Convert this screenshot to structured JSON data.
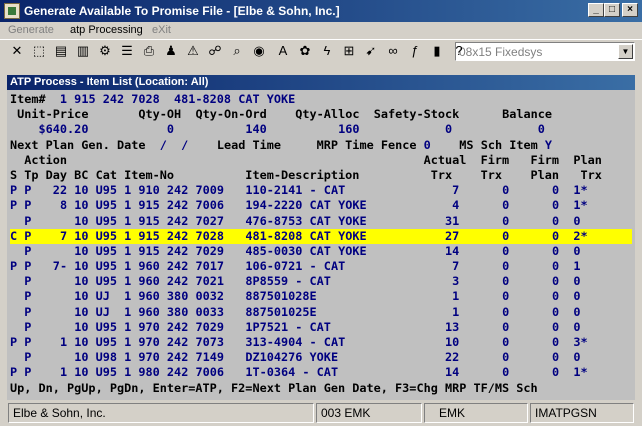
{
  "window": {
    "title": "Generate Available To Promise File - [Elbe & Sohn, Inc.]",
    "controls": [
      "_",
      "□",
      "×"
    ]
  },
  "menu": [
    {
      "label": "Generate",
      "enabled": false
    },
    {
      "label": "atp Processing",
      "enabled": true
    },
    {
      "label": "eXit",
      "enabled": false
    }
  ],
  "toolbar": {
    "buttons": [
      {
        "name": "close-icon",
        "glyph": "✕"
      },
      {
        "name": "select-icon",
        "glyph": "⬚"
      },
      {
        "name": "document-icon",
        "glyph": "▤"
      },
      {
        "name": "clipboard-icon",
        "glyph": "▥"
      },
      {
        "name": "settings-icon",
        "glyph": "⚙"
      },
      {
        "name": "list-icon",
        "glyph": "☰"
      },
      {
        "name": "print-icon",
        "glyph": "⎙"
      },
      {
        "name": "user-icon",
        "glyph": "♟"
      },
      {
        "name": "warning-icon",
        "glyph": "⚠"
      },
      {
        "name": "binoculars-icon",
        "glyph": "☍"
      },
      {
        "name": "search-icon",
        "glyph": "⌕"
      },
      {
        "name": "globe-icon",
        "glyph": "◉"
      },
      {
        "name": "font-icon",
        "glyph": "A"
      },
      {
        "name": "gear-icon",
        "glyph": "✿"
      },
      {
        "name": "lightning-icon",
        "glyph": "ϟ"
      },
      {
        "name": "calc-icon",
        "glyph": "⊞"
      },
      {
        "name": "run-icon",
        "glyph": "➹"
      },
      {
        "name": "link-icon",
        "glyph": "∞"
      },
      {
        "name": "function-icon",
        "glyph": "ƒ"
      },
      {
        "name": "book-icon",
        "glyph": "▮"
      },
      {
        "name": "help-icon",
        "glyph": "?"
      }
    ],
    "font_selector": "08x15 Fixedsys"
  },
  "panel": {
    "title": "ATP Process - Item List (Location: All)"
  },
  "header": {
    "item_label": "Item#",
    "item_no": "1 915 242 7028",
    "item_code": "481-8208 CAT YOKE",
    "unit_price_label": "Unit-Price",
    "qty_oh_label": "Qty-OH",
    "qty_on_ord_label": "Qty-On-Ord",
    "qty_alloc_label": "Qty-Alloc",
    "safety_stock_label": "Safety-Stock",
    "balance_label": "Balance",
    "unit_price": "$640.20",
    "qty_oh": "0",
    "qty_on_ord": "140",
    "qty_alloc": "160",
    "safety_stock": "0",
    "balance": "0",
    "next_plan_label": "Next Plan Gen. Date",
    "next_plan_value": "/  /",
    "lead_time_label": "Lead Time",
    "mrp_fence_label": "MRP Time Fence",
    "mrp_fence_value": "0",
    "ms_label": "MS",
    "sch_item_label": "Sch Item",
    "sch_item_value": "Y"
  },
  "columns": {
    "line1": "  Action                                                  Actual  Firm   Firm  Plan",
    "line2": "S Tp Day BC Cat Item-No          Item-Description          Trx    Trx    Plan   Trx"
  },
  "rows": [
    {
      "s": "P",
      "tp": "P",
      "day": "22",
      "bc": "10",
      "cat": "U95",
      "item": "1 910 242 7009",
      "desc": "110-2141 - CAT",
      "actual": "7",
      "firm_trx": "0",
      "firm_plan": "0",
      "plan_trx": "1*",
      "highlight": false
    },
    {
      "s": "P",
      "tp": "P",
      "day": "8",
      "bc": "10",
      "cat": "U95",
      "item": "1 915 242 7006",
      "desc": "194-2220 CAT YOKE",
      "actual": "4",
      "firm_trx": "0",
      "firm_plan": "0",
      "plan_trx": "1*",
      "highlight": false
    },
    {
      "s": "",
      "tp": "P",
      "day": "",
      "bc": "10",
      "cat": "U95",
      "item": "1 915 242 7027",
      "desc": "476-8753 CAT YOKE",
      "actual": "31",
      "firm_trx": "0",
      "firm_plan": "0",
      "plan_trx": "0",
      "highlight": false
    },
    {
      "s": "C",
      "tp": "P",
      "day": "7",
      "bc": "10",
      "cat": "U95",
      "item": "1 915 242 7028",
      "desc": "481-8208 CAT YOKE",
      "actual": "27",
      "firm_trx": "0",
      "firm_plan": "0",
      "plan_trx": "2*",
      "highlight": true
    },
    {
      "s": "",
      "tp": "P",
      "day": "",
      "bc": "10",
      "cat": "U95",
      "item": "1 915 242 7029",
      "desc": "485-0030 CAT YOKE",
      "actual": "14",
      "firm_trx": "0",
      "firm_plan": "0",
      "plan_trx": "0",
      "highlight": false
    },
    {
      "s": "P",
      "tp": "P",
      "day": "7-",
      "bc": "10",
      "cat": "U95",
      "item": "1 960 242 7017",
      "desc": "106-0721 - CAT",
      "actual": "7",
      "firm_trx": "0",
      "firm_plan": "0",
      "plan_trx": "1",
      "highlight": false
    },
    {
      "s": "",
      "tp": "P",
      "day": "",
      "bc": "10",
      "cat": "U95",
      "item": "1 960 242 7021",
      "desc": "8P8559 - CAT",
      "actual": "3",
      "firm_trx": "0",
      "firm_plan": "0",
      "plan_trx": "0",
      "highlight": false
    },
    {
      "s": "",
      "tp": "P",
      "day": "",
      "bc": "10",
      "cat": "UJ",
      "item": "1 960 380 0032",
      "desc": "887501028E",
      "actual": "1",
      "firm_trx": "0",
      "firm_plan": "0",
      "plan_trx": "0",
      "highlight": false
    },
    {
      "s": "",
      "tp": "P",
      "day": "",
      "bc": "10",
      "cat": "UJ",
      "item": "1 960 380 0033",
      "desc": "887501025E",
      "actual": "1",
      "firm_trx": "0",
      "firm_plan": "0",
      "plan_trx": "0",
      "highlight": false
    },
    {
      "s": "",
      "tp": "P",
      "day": "",
      "bc": "10",
      "cat": "U95",
      "item": "1 970 242 7029",
      "desc": "1P7521 - CAT",
      "actual": "13",
      "firm_trx": "0",
      "firm_plan": "0",
      "plan_trx": "0",
      "highlight": false
    },
    {
      "s": "P",
      "tp": "P",
      "day": "1",
      "bc": "10",
      "cat": "U95",
      "item": "1 970 242 7073",
      "desc": "313-4904 - CAT",
      "actual": "10",
      "firm_trx": "0",
      "firm_plan": "0",
      "plan_trx": "3*",
      "highlight": false
    },
    {
      "s": "",
      "tp": "P",
      "day": "",
      "bc": "10",
      "cat": "U98",
      "item": "1 970 242 7149",
      "desc": "DZ104276 YOKE",
      "actual": "22",
      "firm_trx": "0",
      "firm_plan": "0",
      "plan_trx": "0",
      "highlight": false
    },
    {
      "s": "P",
      "tp": "P",
      "day": "1",
      "bc": "10",
      "cat": "U95",
      "item": "1 980 242 7006",
      "desc": "1T-0364 - CAT",
      "actual": "14",
      "firm_trx": "0",
      "firm_plan": "0",
      "plan_trx": "1*",
      "highlight": false
    }
  ],
  "help_line": "Up, Dn, PgUp, PgDn, Enter=ATP, F2=Next Plan Gen Date, F3=Chg MRP TF/MS Sch",
  "status": {
    "company": "Elbe & Sohn, Inc.",
    "user_code": "003 EMK",
    "user": "EMK",
    "program": "IMATPGSN"
  }
}
